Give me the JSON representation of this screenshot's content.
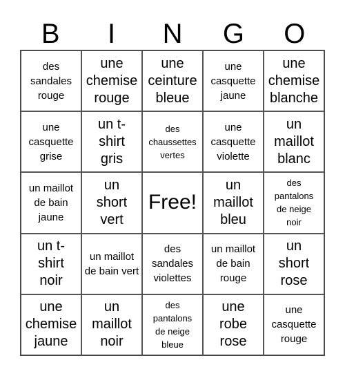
{
  "header": [
    "B",
    "I",
    "N",
    "G",
    "O"
  ],
  "cells": [
    [
      "des sandales rouge",
      "une chemise rouge",
      "une ceinture bleue",
      "une casquette jaune",
      "une chemise blanche"
    ],
    [
      "une casquette grise",
      "un t-shirt gris",
      "des chaussettes vertes",
      "une casquette violette",
      "un maillot blanc"
    ],
    [
      "un maillot de bain jaune",
      "un short vert",
      "Free!",
      "un maillot bleu",
      "des pantalons de neige noir"
    ],
    [
      "un t-shirt noir",
      "un maillot de bain vert",
      "des sandales violettes",
      "un maillot de bain rouge",
      "un short rose"
    ],
    [
      "une chemise jaune",
      "un maillot noir",
      "des pantalons de neige bleue",
      "une robe rose",
      "une casquette rouge"
    ]
  ],
  "free_space": "Free!"
}
